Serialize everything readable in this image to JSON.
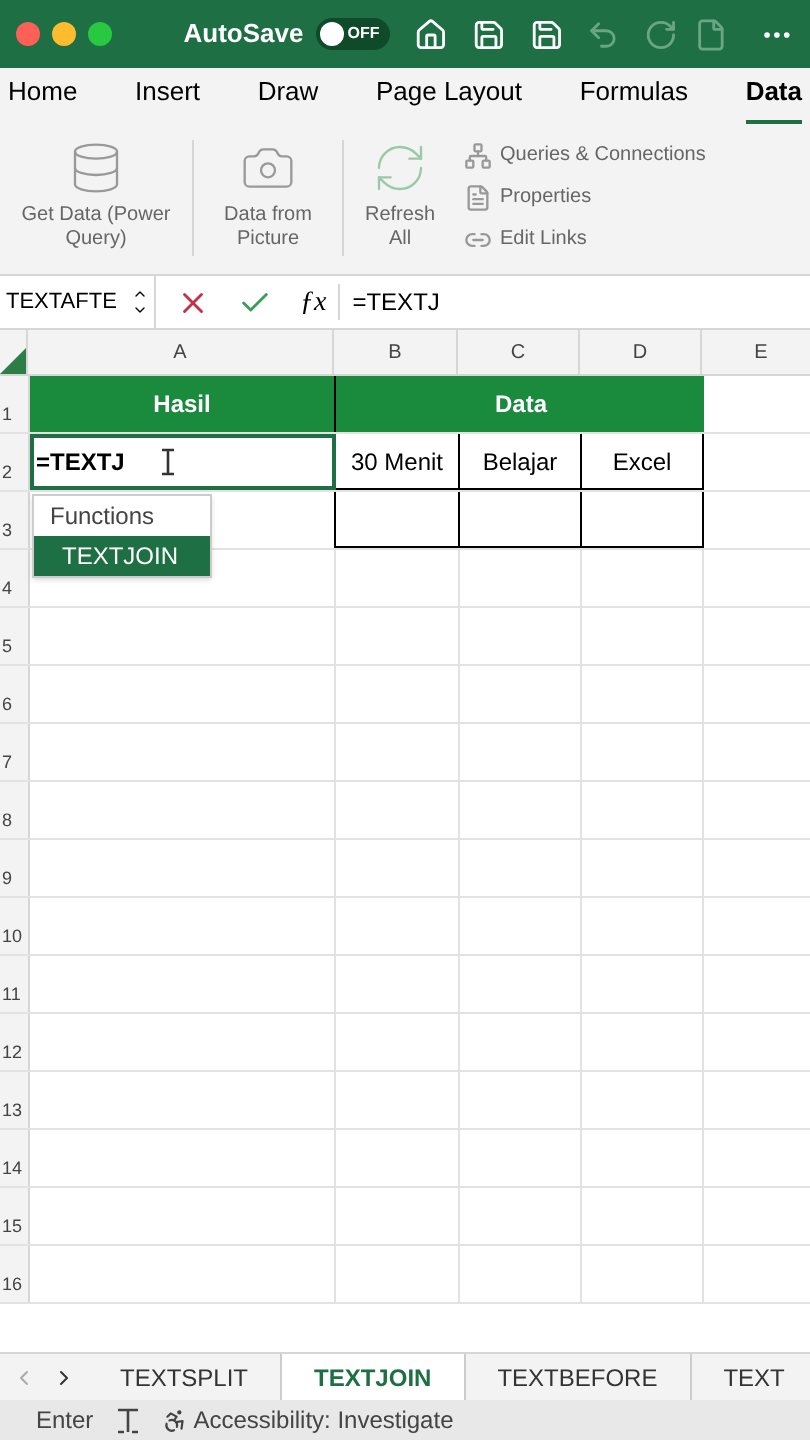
{
  "title_bar": {
    "autosave_label": "AutoSave",
    "autosave_toggle": {
      "on": false,
      "label": "OFF"
    }
  },
  "ribbon_tabs": [
    {
      "label": "Home",
      "selected": false
    },
    {
      "label": "Insert",
      "selected": false
    },
    {
      "label": "Draw",
      "selected": false
    },
    {
      "label": "Page Layout",
      "selected": false
    },
    {
      "label": "Formulas",
      "selected": false
    },
    {
      "label": "Data",
      "selected": true
    }
  ],
  "ribbon": {
    "get_data": "Get Data (Power Query)",
    "data_from_picture": "Data from Picture",
    "refresh_all": "Refresh All",
    "queries_connections": "Queries & Connections",
    "properties": "Properties",
    "edit_links": "Edit Links"
  },
  "formula_bar": {
    "name_box": "TEXTAFTE",
    "function_label": "ƒx",
    "formula": "=TEXTJ"
  },
  "sheet": {
    "columns": [
      "A",
      "B",
      "C",
      "D",
      "E"
    ],
    "rows": [
      {
        "number": "1",
        "cells": [
          {
            "text": "Hasil",
            "kind": "header"
          },
          {
            "text": "",
            "kind": "header"
          },
          {
            "text": "Data",
            "kind": "header"
          },
          {
            "text": "",
            "kind": "header"
          }
        ]
      },
      {
        "number": "2",
        "cells": [
          {
            "text": "=TEXTJ",
            "kind": "editing"
          },
          {
            "text": "30 Menit",
            "kind": "data"
          },
          {
            "text": "Belajar",
            "kind": "data"
          },
          {
            "text": "Excel",
            "kind": "data"
          }
        ]
      },
      {
        "number": "3",
        "cells": []
      },
      {
        "number": "4",
        "cells": []
      },
      {
        "number": "5",
        "cells": []
      },
      {
        "number": "6",
        "cells": []
      },
      {
        "number": "7",
        "cells": []
      },
      {
        "number": "8",
        "cells": []
      },
      {
        "number": "9",
        "cells": []
      },
      {
        "number": "10",
        "cells": []
      },
      {
        "number": "11",
        "cells": []
      },
      {
        "number": "12",
        "cells": []
      },
      {
        "number": "13",
        "cells": []
      },
      {
        "number": "14",
        "cells": []
      },
      {
        "number": "15",
        "cells": []
      },
      {
        "number": "16",
        "cells": []
      }
    ]
  },
  "autocomplete": {
    "heading": "Functions",
    "items": [
      {
        "label": "TEXTJOIN",
        "selected": true
      }
    ]
  },
  "sheet_tabs": [
    {
      "label": "TEXTSPLIT",
      "selected": false
    },
    {
      "label": "TEXTJOIN",
      "selected": true
    },
    {
      "label": "TEXTBEFORE",
      "selected": false
    },
    {
      "label": "TEXT",
      "selected": false
    }
  ],
  "status_bar": {
    "mode": "Enter",
    "accessibility": "Accessibility: Investigate"
  }
}
